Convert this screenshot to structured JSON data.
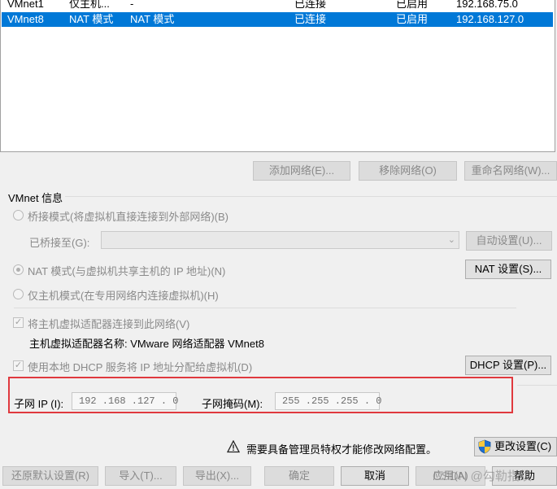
{
  "network_list": {
    "rows": [
      {
        "name": "VMnet1",
        "type": "仅主机...",
        "external": "-",
        "host_connection": "已连接",
        "dhcp": "已启用",
        "subnet": "192.168.75.0",
        "selected": false
      },
      {
        "name": "VMnet8",
        "type": "NAT 模式",
        "external": "NAT 模式",
        "host_connection": "已连接",
        "dhcp": "已启用",
        "subnet": "192.168.127.0",
        "selected": true
      }
    ]
  },
  "list_buttons": {
    "add": "添加网络(E)...",
    "remove": "移除网络(O)",
    "rename": "重命名网络(W)..."
  },
  "vmnet_info": {
    "group_title": "VMnet 信息",
    "bridged_label": "桥接模式(将虚拟机直接连接到外部网络)(B)",
    "bridged_to_label": "已桥接至(G):",
    "bridged_to_value": "",
    "auto_settings": "自动设置(U)...",
    "nat_label": "NAT 模式(与虚拟机共享主机的 IP 地址)(N)",
    "nat_settings": "NAT 设置(S)...",
    "hostonly_label": "仅主机模式(在专用网络内连接虚拟机)(H)",
    "connect_adapter_label": "将主机虚拟适配器连接到此网络(V)",
    "adapter_name_label": "主机虚拟适配器名称: VMware 网络适配器 VMnet8",
    "dhcp_label": "使用本地 DHCP 服务将 IP 地址分配给虚拟机(D)",
    "dhcp_settings": "DHCP 设置(P)...",
    "subnet_ip_label": "子网 IP (I):",
    "subnet_ip_value": "192 .168 .127 .  0",
    "subnet_mask_label": "子网掩码(M):",
    "subnet_mask_value": "255 .255 .255 .  0",
    "selected_mode": "nat"
  },
  "admin_notice": {
    "text": "需要具备管理员特权才能修改网络配置。",
    "change_settings": "更改设置(C)"
  },
  "footer": {
    "restore_defaults": "还原默认设置(R)",
    "import": "导入(T)...",
    "export": "导出(X)...",
    "ok": "确定",
    "cancel": "取消",
    "apply": "应用(A)",
    "help": "帮助"
  },
  "watermark": "CSDN @勾勒指纹",
  "colors": {
    "selection": "#0078d7",
    "highlight_box": "#e0393e"
  }
}
